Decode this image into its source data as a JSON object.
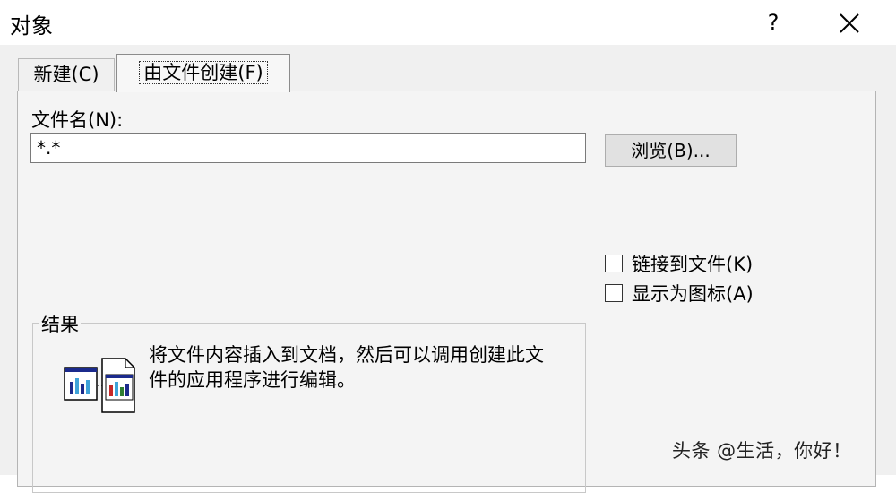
{
  "window": {
    "title": "对象",
    "help_label": "?",
    "close_label": "close"
  },
  "tabs": [
    {
      "label": "新建(C)",
      "selected": false
    },
    {
      "label": "由文件创建(F)",
      "selected": true
    }
  ],
  "file": {
    "label": "文件名(N):",
    "value": "*.*",
    "browse_label": "浏览(B)..."
  },
  "options": {
    "link_label": "链接到文件(K)",
    "link_checked": false,
    "icon_label": "显示为图标(A)",
    "icon_checked": false
  },
  "result": {
    "legend": "结果",
    "description": "将文件内容插入到文档，然后可以调用创建此文件的应用程序进行编辑。",
    "icon": "chart-document-icon"
  },
  "watermark": "头条 @生活，你好！",
  "colors": {
    "bar_dark": "#1b2a8c",
    "bar_light": "#3fa3d8",
    "bar_red": "#c62828",
    "bar_green": "#2e7d32"
  }
}
